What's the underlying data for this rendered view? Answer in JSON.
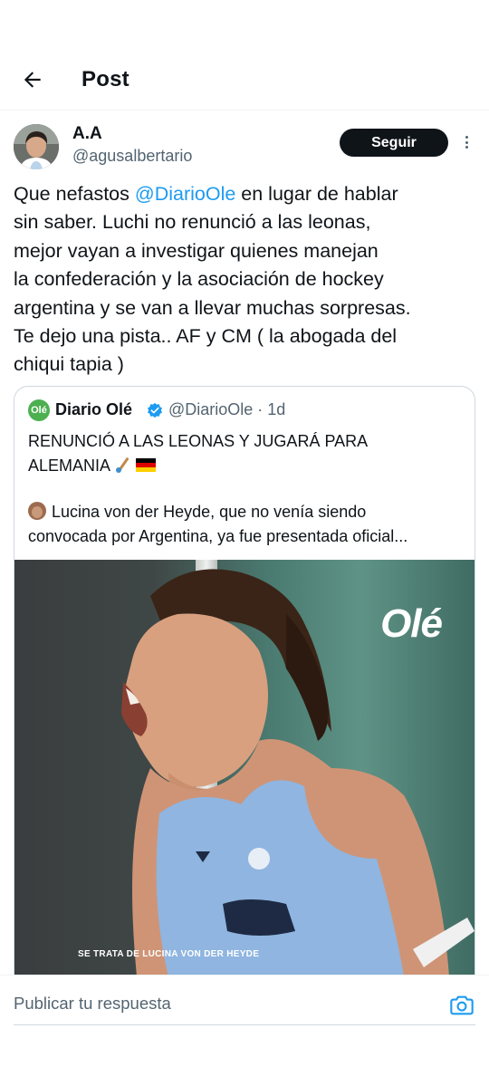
{
  "header": {
    "title": "Post",
    "back_icon": "arrow-left-icon"
  },
  "tweet": {
    "author_name": "A.A",
    "author_handle": "@agusalbertario",
    "follow_label": "Seguir",
    "text_lines": [
      {
        "before": "Que nefastos ",
        "mention": "@DiarioOle",
        "after": " en lugar de hablar"
      },
      "sin saber. Luchi no renunció a las leonas,",
      "mejor vayan a investigar quienes manejan",
      "la confederación y la asociación de hockey",
      "argentina y se van a llevar muchas sorpresas.",
      "Te dejo una pista.. AF y CM ( la abogada del",
      "chiqui tapia )"
    ]
  },
  "quote": {
    "avatar_text": "Olé",
    "name": "Diario Olé",
    "handle_time": "@DiarioOle · 1d",
    "text_line1": "RENUNCIÓ A LAS LEONAS Y JUGARÁ PARA",
    "text_line2": "ALEMANIA",
    "text_line3": "Lucina von der Heyde, que no venía siendo",
    "text_line4": "convocada por Argentina, ya fue presentada oficial...",
    "photo_logo": "Olé",
    "photo_caption": "SE TRATA DE LUCINA VON DER HEYDE",
    "colors": {
      "verified": "#1d9bf0",
      "logo_green": "#4caf50"
    }
  },
  "reply": {
    "placeholder": "Publicar tu respuesta",
    "camera_icon": "camera-icon"
  },
  "colors": {
    "accent": "#1d9bf0",
    "text": "#0f1419",
    "secondary": "#536471"
  }
}
